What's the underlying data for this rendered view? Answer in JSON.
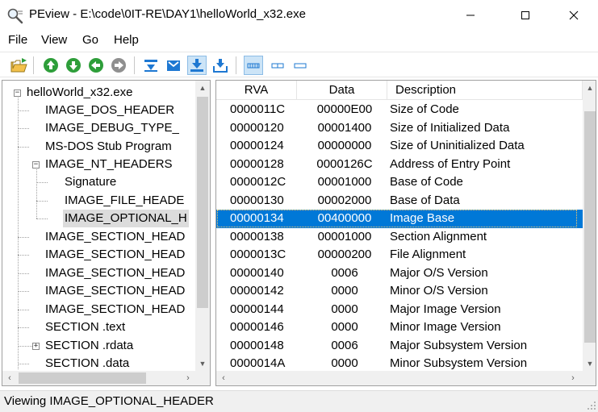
{
  "window": {
    "title": "PEview - E:\\code\\0IT-RE\\DAY1\\helloWorld_x32.exe",
    "app_icon": "magnifier-icon",
    "controls": {
      "minimize": "minimize-icon",
      "maximize": "maximize-icon",
      "close": "close-icon"
    }
  },
  "menu": {
    "file": "File",
    "view": "View",
    "go": "Go",
    "help": "Help"
  },
  "toolbar": {
    "open_icon": "open-folder-icon",
    "nav_icons": [
      "up-arrow-icon",
      "down-arrow-icon",
      "back-arrow-icon",
      "forward-arrow-icon"
    ],
    "view_icons": [
      "collapse-icon",
      "expand-icon",
      "view-down-pressed-icon",
      "view-down-icon"
    ],
    "size_icons": [
      "byte-view-icon",
      "word-view-icon",
      "dword-view-icon"
    ]
  },
  "tree": {
    "root": "helloWorld_x32.exe",
    "items": [
      "IMAGE_DOS_HEADER",
      "IMAGE_DEBUG_TYPE_",
      "MS-DOS Stub Program",
      "IMAGE_NT_HEADERS",
      "Signature",
      "IMAGE_FILE_HEADE",
      "IMAGE_OPTIONAL_H",
      "IMAGE_SECTION_HEAD",
      "IMAGE_SECTION_HEAD",
      "IMAGE_SECTION_HEAD",
      "IMAGE_SECTION_HEAD",
      "IMAGE_SECTION_HEAD",
      "SECTION .text",
      "SECTION .rdata",
      "SECTION .data"
    ],
    "selected": "IMAGE_OPTIONAL_H"
  },
  "list": {
    "columns": {
      "rva": "RVA",
      "data": "Data",
      "description": "Description"
    },
    "rows": [
      {
        "rva": "0000011C",
        "data": "00000E00",
        "desc": "Size of Code"
      },
      {
        "rva": "00000120",
        "data": "00001400",
        "desc": "Size of Initialized Data"
      },
      {
        "rva": "00000124",
        "data": "00000000",
        "desc": "Size of Uninitialized Data"
      },
      {
        "rva": "00000128",
        "data": "0000126C",
        "desc": "Address of Entry Point"
      },
      {
        "rva": "0000012C",
        "data": "00001000",
        "desc": "Base of Code"
      },
      {
        "rva": "00000130",
        "data": "00002000",
        "desc": "Base of Data"
      },
      {
        "rva": "00000134",
        "data": "00400000",
        "desc": "Image Base"
      },
      {
        "rva": "00000138",
        "data": "00001000",
        "desc": "Section Alignment"
      },
      {
        "rva": "0000013C",
        "data": "00000200",
        "desc": "File Alignment"
      },
      {
        "rva": "00000140",
        "data": "0006",
        "desc": "Major O/S Version"
      },
      {
        "rva": "00000142",
        "data": "0000",
        "desc": "Minor O/S Version"
      },
      {
        "rva": "00000144",
        "data": "0000",
        "desc": "Major Image Version"
      },
      {
        "rva": "00000146",
        "data": "0000",
        "desc": "Minor Image Version"
      },
      {
        "rva": "00000148",
        "data": "0006",
        "desc": "Major Subsystem Version"
      },
      {
        "rva": "0000014A",
        "data": "0000",
        "desc": "Minor Subsystem Version"
      }
    ],
    "selected_rva": "00000134"
  },
  "status": {
    "text": "Viewing IMAGE_OPTIONAL_HEADER"
  },
  "colors": {
    "selection": "#0078d7",
    "tree_selection": "#dcdcdc",
    "nav_green": "#2e9e3a",
    "nav_gray": "#8f8f8f",
    "toolbar_blue": "#1e78d2"
  }
}
